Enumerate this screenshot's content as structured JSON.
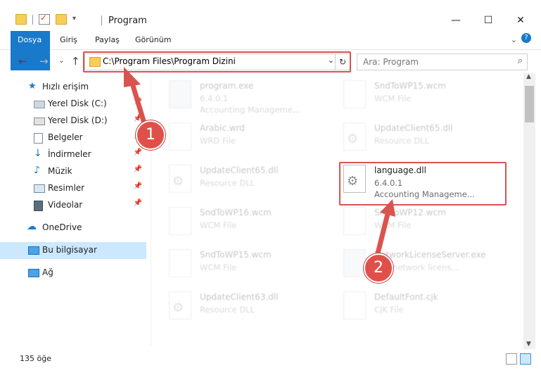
{
  "window": {
    "title": "Program",
    "minimize": "—",
    "maximize": "☐",
    "close": "✕"
  },
  "ribbon": {
    "tabs": [
      "Dosya",
      "Giriş",
      "Paylaş",
      "Görünüm"
    ]
  },
  "address": {
    "path": "C:\\Program Files\\Program Dizini"
  },
  "search": {
    "placeholder": "Ara: Program"
  },
  "sidebar": {
    "items": [
      {
        "label": "Hızlı erişim"
      },
      {
        "label": "Yerel Disk (C:)"
      },
      {
        "label": "Yerel Disk (D:)"
      },
      {
        "label": "Belgeler"
      },
      {
        "label": "İndirmeler"
      },
      {
        "label": "Müzik"
      },
      {
        "label": "Resimler"
      },
      {
        "label": "Videolar"
      },
      {
        "label": "OneDrive"
      },
      {
        "label": "Bu bilgisayar"
      },
      {
        "label": "Ağ"
      }
    ]
  },
  "files": [
    {
      "name": "program.exe",
      "l1": "6.4.0.1",
      "l2": "Accounting Manageme..."
    },
    {
      "name": "SndToWP15.wcm",
      "l1": "WCM File",
      "l2": ""
    },
    {
      "name": "Arabic.wrd",
      "l1": "WRD File",
      "l2": ""
    },
    {
      "name": "UpdateClient65.dll",
      "l1": "Resource DLL",
      "l2": ""
    },
    {
      "name": "UpdateClient65.dll",
      "l1": "Resource DLL",
      "l2": ""
    },
    {
      "name": "language.dll",
      "l1": "6.4.0.1",
      "l2": "Accounting Manageme..."
    },
    {
      "name": "SndToWP16.wcm",
      "l1": "WCM File",
      "l2": ""
    },
    {
      "name": "SndToWP12.wcm",
      "l1": "WCM File",
      "l2": ""
    },
    {
      "name": "SndToWP15.wcm",
      "l1": "WCM File",
      "l2": ""
    },
    {
      "name": "NetworkLicenseServer.exe",
      "l1": "RKY network licens...",
      "l2": ""
    },
    {
      "name": "UpdateClient63.dll",
      "l1": "Resource DLL",
      "l2": ""
    },
    {
      "name": "DefaultFont.cjk",
      "l1": "CJK File",
      "l2": ""
    }
  ],
  "status": {
    "count": "135 öğe"
  },
  "annotations": {
    "badge1": "1",
    "badge2": "2",
    "color": "#d9534f"
  }
}
